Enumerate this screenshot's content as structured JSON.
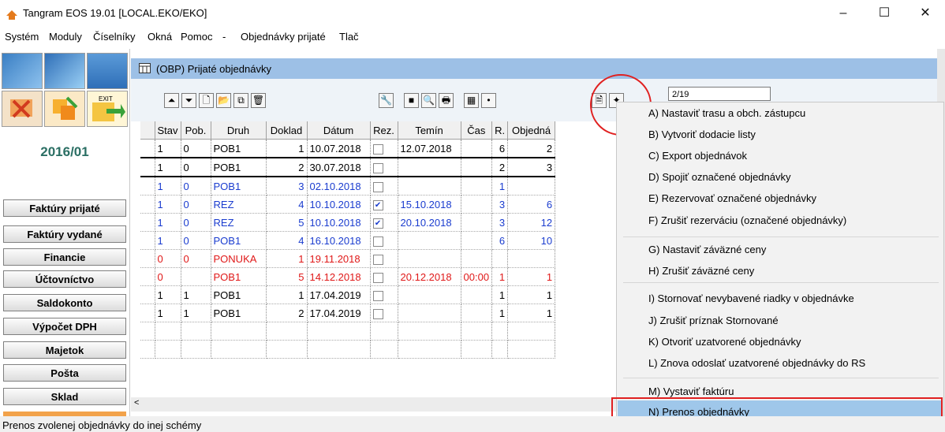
{
  "window": {
    "title": "Tangram EOS 19.01 [LOCAL.EKO/EKO]",
    "minimize": "–",
    "maximize": "☐",
    "close": "✕"
  },
  "menubar": [
    "Systém",
    "Moduly",
    "Číselníky",
    "Okná",
    "Pomoc",
    "-",
    "Objednávky prijaté",
    "Tlač"
  ],
  "sidebar": {
    "period": "2016/01",
    "items": [
      "Faktúry prijaté",
      "Faktúry vydané",
      "Financie",
      "Účtovníctvo",
      "Saldokonto",
      "Výpočet DPH",
      "Majetok",
      "Pošta",
      "Sklad"
    ],
    "exit_label": "EXIT"
  },
  "inner_window": {
    "title": "(OBP) Prijaté objednávky",
    "search_value": "2/19"
  },
  "grid": {
    "columns": [
      "Stav",
      "Pob.",
      "Druh",
      "Doklad",
      "Dátum",
      "Rez.",
      "Temín",
      "Čas",
      "R.",
      "Objedná"
    ],
    "rows": [
      {
        "stav": "1",
        "pob": "0",
        "druh": "POB1",
        "doklad": "1",
        "datum": "10.07.2018",
        "rez": false,
        "termin": "12.07.2018",
        "cas": "",
        "r": "6",
        "obj": "2",
        "color": "black"
      },
      {
        "stav": "1",
        "pob": "0",
        "druh": "POB1",
        "doklad": "2",
        "datum": "30.07.2018",
        "rez": false,
        "termin": "",
        "cas": "",
        "r": "2",
        "obj": "3",
        "color": "black",
        "selected": true
      },
      {
        "stav": "1",
        "pob": "0",
        "druh": "POB1",
        "doklad": "3",
        "datum": "02.10.2018",
        "rez": false,
        "termin": "",
        "cas": "",
        "r": "1",
        "obj": "",
        "color": "blue"
      },
      {
        "stav": "1",
        "pob": "0",
        "druh": "REZ",
        "doklad": "4",
        "datum": "10.10.2018",
        "rez": true,
        "termin": "15.10.2018",
        "cas": "",
        "r": "3",
        "obj": "6",
        "color": "blue"
      },
      {
        "stav": "1",
        "pob": "0",
        "druh": "REZ",
        "doklad": "5",
        "datum": "10.10.2018",
        "rez": true,
        "termin": "20.10.2018",
        "cas": "",
        "r": "3",
        "obj": "12",
        "color": "blue"
      },
      {
        "stav": "1",
        "pob": "0",
        "druh": "POB1",
        "doklad": "4",
        "datum": "16.10.2018",
        "rez": false,
        "termin": "",
        "cas": "",
        "r": "6",
        "obj": "10",
        "color": "blue"
      },
      {
        "stav": "0",
        "pob": "0",
        "druh": "PONUKA",
        "doklad": "1",
        "datum": "19.11.2018",
        "rez": false,
        "termin": "",
        "cas": "",
        "r": "",
        "obj": "",
        "color": "red"
      },
      {
        "stav": "0",
        "pob": "",
        "druh": "POB1",
        "doklad": "5",
        "datum": "14.12.2018",
        "rez": false,
        "termin": "20.12.2018",
        "cas": "00:00",
        "r": "1",
        "obj": "1",
        "color": "red"
      },
      {
        "stav": "1",
        "pob": "1",
        "druh": "POB1",
        "doklad": "1",
        "datum": "17.04.2019",
        "rez": false,
        "termin": "",
        "cas": "",
        "r": "1",
        "obj": "1",
        "color": "black"
      },
      {
        "stav": "1",
        "pob": "1",
        "druh": "POB1",
        "doklad": "2",
        "datum": "17.04.2019",
        "rez": false,
        "termin": "",
        "cas": "",
        "r": "1",
        "obj": "1",
        "color": "black"
      }
    ]
  },
  "context_menu": {
    "items": [
      "A) Nastaviť trasu a obch. zástupcu",
      "B) Vytvoriť dodacie listy",
      "C) Export objednávok",
      "D) Spojiť označené objednávky",
      "E) Rezervovať označené objednávky",
      "F) Zrušiť rezerváciu (označené objednávky)",
      "G) Nastaviť záväzné ceny",
      "H) Zrušiť záväzné ceny",
      "I) Stornovať nevybavené riadky v objednávke",
      "J) Zrušiť príznak Stornované",
      "K) Otvoriť uzatvorené objednávky",
      "L) Znova odoslať uzatvorené objednávky do RS",
      "M) Vystaviť faktúru",
      "N) Prenos objednávky"
    ]
  },
  "status": {
    "text": "Prenos zvolenej objednávky do inej schémy"
  },
  "colors": {
    "blue_row": "#1a3ccf",
    "red_row": "#e01818",
    "accent": "#9dc0e6",
    "highlight": "#9fc7ea",
    "annotation": "#e02020"
  }
}
